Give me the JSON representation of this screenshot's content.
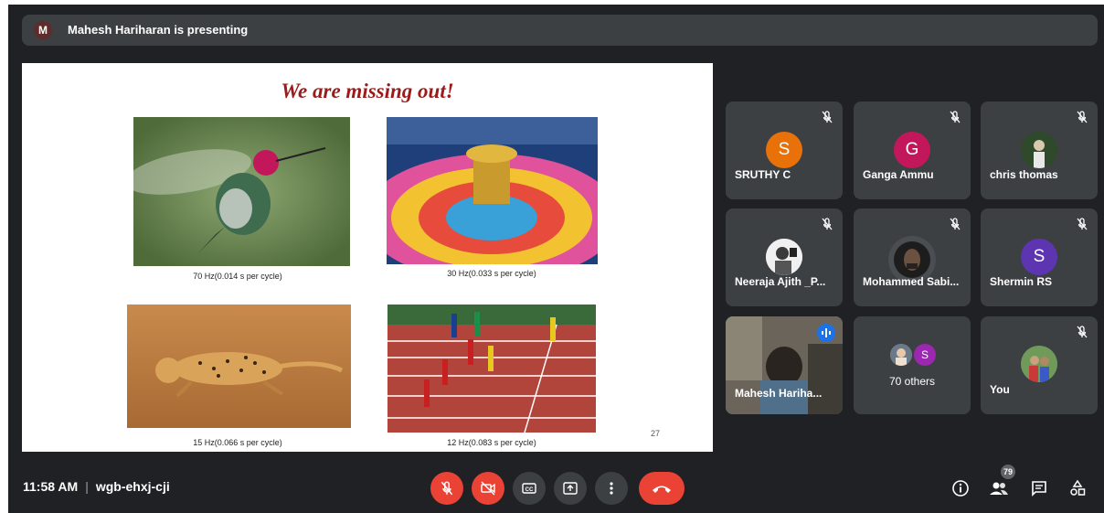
{
  "banner": {
    "avatar_letter": "M",
    "text": "Mahesh Hariharan is presenting"
  },
  "slide": {
    "title": "We are missing out!",
    "captions": [
      "70 Hz(0.014 s per cycle)",
      "30 Hz(0.033 s per cycle)",
      "15 Hz(0.066 s per cycle)",
      "12 Hz(0.083 s per cycle)"
    ],
    "page_number": "27"
  },
  "tiles": [
    {
      "name": "SRUTHY C",
      "letter": "S",
      "color": "#e8710a"
    },
    {
      "name": "Ganga Ammu",
      "letter": "G",
      "color": "#c2185b"
    },
    {
      "name": "chris thomas"
    },
    {
      "name": "Neeraja Ajith _P..."
    },
    {
      "name": "Mohammed Sabi..."
    },
    {
      "name": "Shermin RS",
      "letter": "S",
      "color": "#5e35b1"
    },
    {
      "name": "Mahesh Hariha..."
    },
    {
      "name": "70 others",
      "letter": "S",
      "color": "#9c27b0"
    },
    {
      "name": "You"
    }
  ],
  "bottom": {
    "time": "11:58 AM",
    "separator": "|",
    "meeting_code": "wgb-ehxj-cji",
    "people_count": "79"
  },
  "colors": {
    "background": "#202124",
    "tile": "#3c4043",
    "danger": "#ea4335",
    "accent": "#1a73e8"
  }
}
